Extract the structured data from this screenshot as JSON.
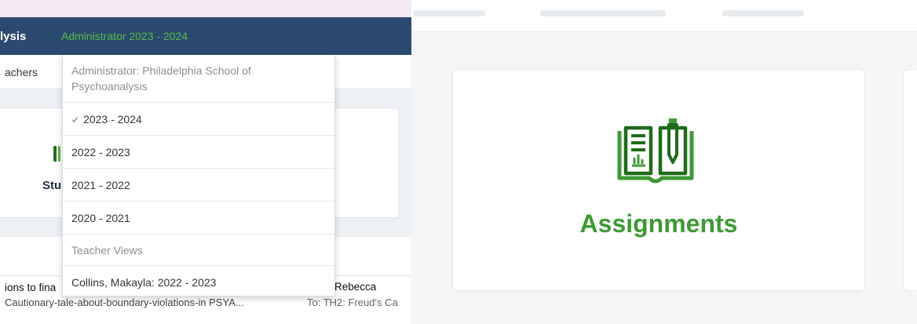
{
  "navbar": {
    "brand_fragment": "lysis",
    "admin_label": "Administrator 2023 - 2024"
  },
  "subnav": {
    "teachers_fragment": "achers"
  },
  "card": {
    "label_fragment": "Stu"
  },
  "dropdown": {
    "header": "Administrator: Philadelphia School of Psychoanalysis",
    "items": [
      {
        "label": "2023 - 2024",
        "selected": true
      },
      {
        "label": "2022 - 2023",
        "selected": false
      },
      {
        "label": "2021 - 2022",
        "selected": false
      },
      {
        "label": "2020 - 2021",
        "selected": false
      }
    ],
    "section_label": "Teacher Views",
    "teacher_item": "Collins, Makayla: 2022 - 2023"
  },
  "row": {
    "title_fragment": "ions to fina",
    "name_fragment": "Rebecca",
    "file": "Cautionary-tale-about-boundary-violations-in PSYA...",
    "to": "To: TH2: Freud's Ca"
  },
  "assignments_card": {
    "label": "Assignments",
    "icon": "assignments-book-icon"
  },
  "colors": {
    "navbar_bg": "#2b4a6f",
    "accent_green": "#57b848",
    "assignments_green": "#3d9a34"
  }
}
